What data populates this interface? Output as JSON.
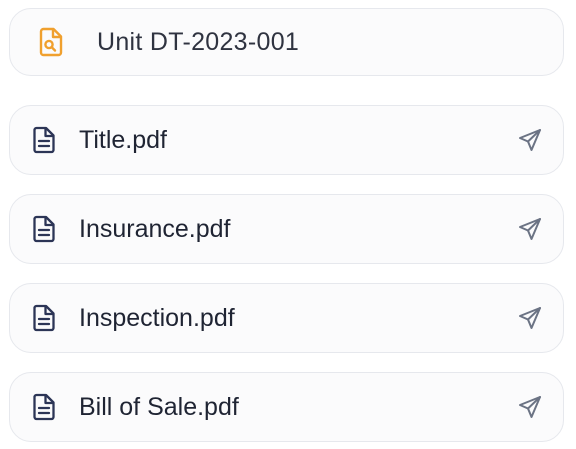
{
  "unit": {
    "title": "Unit DT-2023-001",
    "icon": "file-search-icon",
    "icon_color": "#f0a02e"
  },
  "files": [
    {
      "name": "Title.pdf"
    },
    {
      "name": "Insurance.pdf"
    },
    {
      "name": "Inspection.pdf"
    },
    {
      "name": "Bill of Sale.pdf"
    }
  ],
  "colors": {
    "file_icon": "#2c3556",
    "send_icon": "#6b7384",
    "card_border": "#e6e8ed",
    "card_bg": "#fbfbfc"
  }
}
